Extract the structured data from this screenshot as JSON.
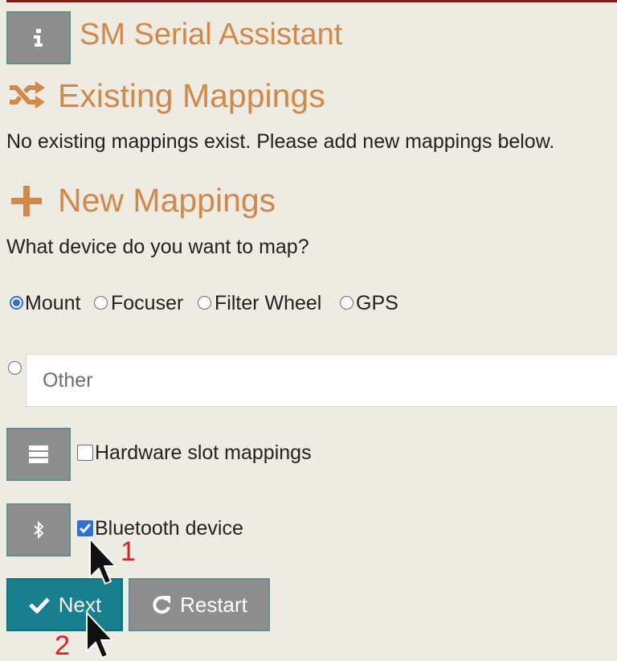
{
  "app": {
    "title": "SM Serial Assistant",
    "info_icon": "info-icon"
  },
  "existing": {
    "heading": "Existing Mappings",
    "icon": "shuffle-icon",
    "message": "No existing mappings exist. Please add new mappings below."
  },
  "new_mappings": {
    "heading": "New Mappings",
    "icon": "plus-icon",
    "question": "What device do you want to map?",
    "device_options": [
      "Mount",
      "Focuser",
      "Filter Wheel",
      "GPS"
    ],
    "selected_device": "Mount",
    "other_placeholder": "Other",
    "hardware_slot_label": "Hardware slot mappings",
    "hardware_slot_checked": false,
    "hardware_slot_icon": "list-icon",
    "bluetooth_label": "Bluetooth device",
    "bluetooth_checked": true,
    "bluetooth_icon": "bluetooth-icon"
  },
  "actions": {
    "next_label": "Next",
    "next_icon": "check-icon",
    "restart_label": "Restart",
    "restart_icon": "redo-icon"
  },
  "annotations": {
    "step1": "1",
    "step2": "2"
  },
  "colors": {
    "background": "#eeebe2",
    "heading_orange": "#d0884b",
    "next_teal": "#177f8e",
    "gray_button": "#8e8e8e",
    "checkbox_blue": "#2f6fd6",
    "annotation_red": "#e0201e"
  }
}
